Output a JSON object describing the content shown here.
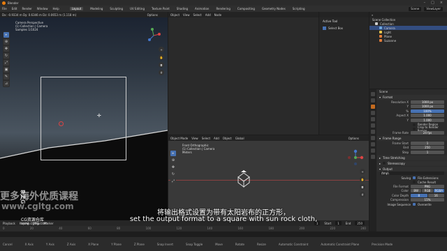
{
  "window": {
    "title": "Blender"
  },
  "menu": {
    "items": [
      "File",
      "Edit",
      "Render",
      "Window",
      "Help"
    ],
    "workspaces": [
      "Layout",
      "Modeling",
      "Sculpting",
      "UV Editing",
      "Texture Paint",
      "Shading",
      "Animation",
      "Rendering",
      "Compositing",
      "Geometry Nodes",
      "Scripting"
    ],
    "scene": "Scene",
    "view_layer": "ViewLayer"
  },
  "left_viewport": {
    "header": [
      "Options"
    ],
    "coords": "Dx: -0.9334 m  Dy: 0.6346 m  Dz: 0.0653 m (1.118 m)",
    "info": [
      "Camera Perspective",
      "(1) Collection | Camera",
      "Samples 1/1024"
    ],
    "logo_text": "RZG",
    "tools": [
      "select",
      "cursor",
      "move",
      "rotate",
      "scale",
      "transform",
      "annotate",
      "measure"
    ]
  },
  "center_top": {
    "header": [
      "Object",
      "View",
      "Select",
      "Add",
      "Node"
    ]
  },
  "tool_panel": {
    "title": "Active Tool",
    "row": "Select Box"
  },
  "center_bottom": {
    "header": [
      "Object Mode",
      "View",
      "Select",
      "Add",
      "Object",
      "Global"
    ],
    "info": [
      "Front Orthographic",
      "(1) Collection | Camera",
      "Meters"
    ],
    "options": "Options"
  },
  "outliner": {
    "title": "Scene Collection",
    "items": [
      {
        "label": "Collection",
        "color": "#cfcfcf",
        "selected": false
      },
      {
        "label": "Camera",
        "color": "#6fa8dc",
        "selected": true
      },
      {
        "label": "Light",
        "color": "#e6c44c",
        "selected": false
      },
      {
        "label": "Plane",
        "color": "#e07b39",
        "selected": false
      },
      {
        "label": "Suzanne",
        "color": "#e07b39",
        "selected": false
      }
    ]
  },
  "properties": {
    "scene": "Scene",
    "format_title": "Format",
    "rows": [
      {
        "label": "Resolution X",
        "value": "1000 px"
      },
      {
        "label": "Y",
        "value": "1000 px"
      },
      {
        "label": "%",
        "value": "100%",
        "blue": true
      },
      {
        "label": "Aspect X",
        "value": "1.000"
      },
      {
        "label": "Y",
        "value": "1.000"
      }
    ],
    "render_region": "Render Region",
    "crop": "Crop to Render Region",
    "frame_rate_label": "Frame Rate",
    "frame_rate": "24 fps",
    "frame_range_title": "Frame Range",
    "frame_rows": [
      {
        "label": "Frame Start",
        "value": "1"
      },
      {
        "label": "End",
        "value": "250"
      },
      {
        "label": "Step",
        "value": "1"
      }
    ],
    "time_stretching": "Time Stretching",
    "stereoscopy": "Stereoscopy",
    "output_title": "Output",
    "output_path": "/tmp\\",
    "saving": "Saving",
    "file_ext": "File Extensions",
    "cache": "Cache Result",
    "file_format_label": "File Format",
    "file_format": "PNG",
    "color_label": "Color",
    "color_opts": [
      "BW",
      "RGB",
      "RGBA"
    ],
    "depth_label": "Color Depth",
    "depth_opts": [
      "8",
      "16"
    ],
    "compression_label": "Compression",
    "compression": "15%",
    "seq_label": "Image Sequence",
    "overwrite": "Overwrite"
  },
  "timeline": {
    "menus": [
      "Playback",
      "Keying",
      "View",
      "Marker"
    ],
    "ticks": [
      "0",
      "20",
      "40",
      "60",
      "80",
      "100",
      "120",
      "140",
      "160",
      "180",
      "200",
      "220",
      "240"
    ],
    "frame": "1",
    "start_label": "Start",
    "start": "1",
    "end_label": "End",
    "end": "250"
  },
  "status": [
    "Cancel",
    "X Axis",
    "Y Axis",
    "Z Axis",
    "X Plane",
    "Y Plane",
    "Z Plane",
    "Snap Invert",
    "Snap Toggle",
    "Move",
    "Rotate",
    "Resize",
    "Automatic Constraint",
    "Automatic Constraint Plane",
    "Precision Mode"
  ],
  "subtitles": {
    "zh": "将输出格式设置为带有太阳岩布的正方形，",
    "en": "set the output format to a square with sun rock cloth,"
  },
  "watermark": {
    "line1": "更多海外优质课程",
    "line2": "www.cgltg.com",
    "line3": "CG资源仓库",
    "line4": "www.cgltg.com"
  }
}
